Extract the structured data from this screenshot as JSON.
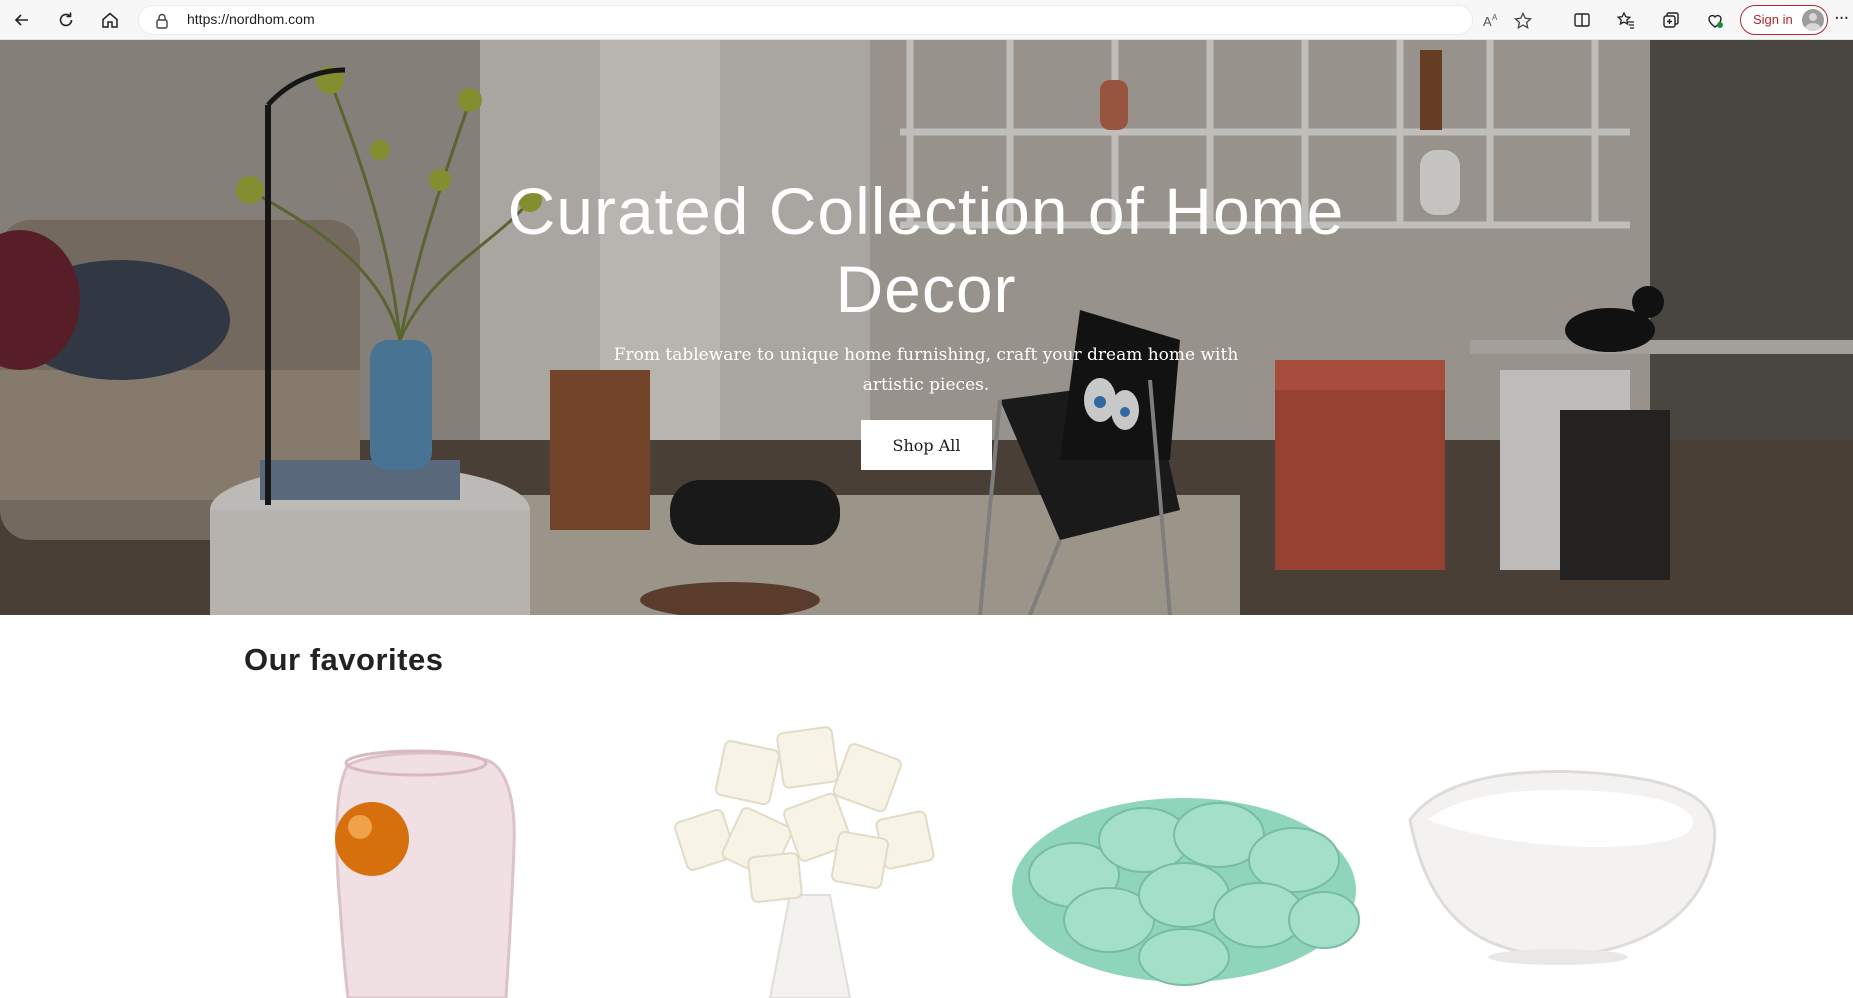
{
  "browser": {
    "url": "https://nordhom.com",
    "sign_in_label": "Sign in",
    "toolbar_icons": [
      "back-icon",
      "refresh-icon",
      "home-icon",
      "lock-icon",
      "read-aloud-icon",
      "favorite-star-icon",
      "split-screen-icon",
      "favorites-icon",
      "collections-icon",
      "browser-essentials-icon",
      "more-icon"
    ]
  },
  "hero": {
    "title": "Curated Collection of Home Decor",
    "subtitle": "From tableware to unique home furnishing, craft your dream home with artistic pieces.",
    "cta_label": "Shop All"
  },
  "favorites": {
    "heading": "Our favorites",
    "products": [
      {
        "image": "pink-glass-vase-with-amber-ball"
      },
      {
        "image": "white-cube-petal-table-lamp"
      },
      {
        "image": "mint-knitted-knot-cushion"
      },
      {
        "image": "white-organic-ceramic-bowl"
      }
    ]
  },
  "colors": {
    "sign_in_accent": "#b3262e",
    "hero_text": "#ffffff",
    "cta_background": "#ffffff"
  }
}
